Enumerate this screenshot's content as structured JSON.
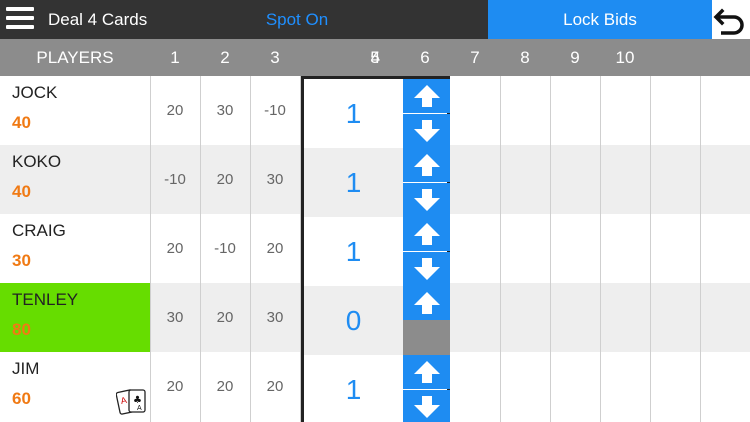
{
  "topbar": {
    "title": "Deal 4 Cards",
    "spot_on": "Spot On",
    "lock_bids": "Lock Bids"
  },
  "header": {
    "players_label": "PLAYERS",
    "rounds": [
      "1",
      "2",
      "3",
      "4",
      "5",
      "6",
      "7",
      "8",
      "9",
      "10"
    ]
  },
  "players": [
    {
      "name": "JOCK",
      "score": "40",
      "highlight": false,
      "scores": [
        "20",
        "30",
        "-10"
      ],
      "bid": "1",
      "can_increase": true,
      "can_decrease": true
    },
    {
      "name": "KOKO",
      "score": "40",
      "highlight": false,
      "scores": [
        "-10",
        "20",
        "30"
      ],
      "bid": "1",
      "can_increase": true,
      "can_decrease": true
    },
    {
      "name": "CRAIG",
      "score": "30",
      "highlight": false,
      "scores": [
        "20",
        "-10",
        "20"
      ],
      "bid": "1",
      "can_increase": true,
      "can_decrease": true
    },
    {
      "name": "TENLEY",
      "score": "80",
      "highlight": true,
      "scores": [
        "30",
        "20",
        "30"
      ],
      "bid": "0",
      "can_increase": true,
      "can_decrease": false
    },
    {
      "name": "JIM",
      "score": "60",
      "highlight": false,
      "dealer": true,
      "scores": [
        "20",
        "20",
        "20"
      ],
      "bid": "1",
      "can_increase": true,
      "can_decrease": true
    }
  ],
  "colors": {
    "accent": "#1e8cf2",
    "score_text": "#f07a14",
    "highlight_row": "#66dd00",
    "header_bg": "#8c8c8c",
    "topbar_bg": "#333333"
  },
  "icons": {
    "menu": "hamburger-menu-icon",
    "back": "undo-arrow-icon",
    "increase": "up-arrow-icon",
    "decrease": "down-arrow-icon",
    "dealer": "playing-cards-icon"
  }
}
